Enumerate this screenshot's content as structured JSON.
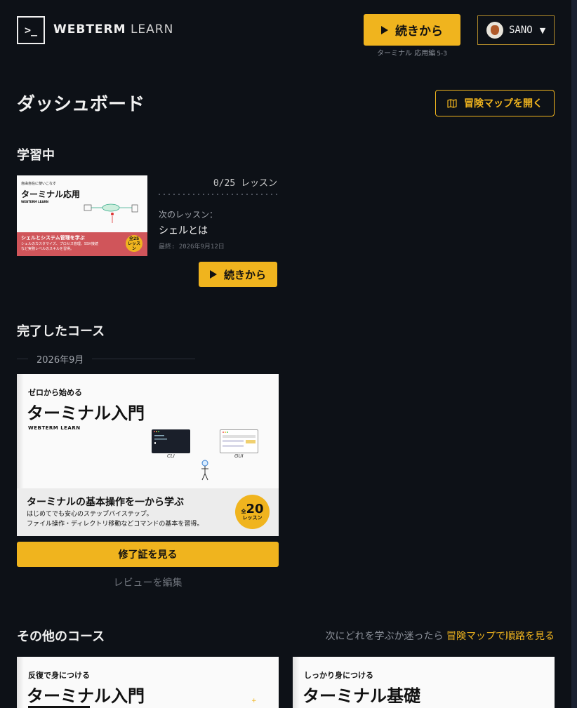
{
  "header": {
    "logo_glyph": ">_",
    "brand_bold": "WEBTERM",
    "brand_light": "LEARN",
    "continue_label": "続きから",
    "continue_sub": "ターミナル 応用編",
    "continue_sub_num": "5-3",
    "username": "SANO",
    "caret": "▼"
  },
  "dashboard": {
    "title": "ダッシュボード",
    "map_button": "冒険マップを開く"
  },
  "learning": {
    "section_title": "学習中",
    "thumb": {
      "top": "自由自在に使いこなす",
      "title": "ターミナル応用",
      "brand": "WEBTERM LEARN",
      "bottom_title": "シェルとシステム管理を学ぶ",
      "bottom_desc": "シェルのカスタマイズ、プロセス管理、SSH接続など実務レベルのスキルを習得。",
      "badge": "全25 レッスン"
    },
    "progress": "0/25 レッスン",
    "next_label": "次のレッスン：",
    "next_value": "シェルとは",
    "last_access": "最終: 2026年9月12日",
    "continue_label": "続きから"
  },
  "completed": {
    "section_title": "完了したコース",
    "date": "2026年9月",
    "thumb": {
      "top": "ゼロから始める",
      "title": "ターミナル入門",
      "brand": "WEBTERM LEARN",
      "cli_label": "CLI",
      "gui_label": "GUI",
      "bottom_title": "ターミナルの基本操作を一から学ぶ",
      "bottom_desc1": "はじめてでも安心のステップバイステップ。",
      "bottom_desc2": "ファイル操作・ディレクトリ移動などコマンドの基本を習得。",
      "badge_prefix": "全",
      "badge_num": "20",
      "badge_unit": "レッスン"
    },
    "certificate_button": "修了証を見る",
    "review_link": "レビューを編集"
  },
  "other": {
    "section_title": "その他のコース",
    "hint_prefix": "次にどれを学ぶか迷ったら",
    "hint_link": "冒険マップで順路を見る",
    "courses": [
      {
        "top": "反復で身につける",
        "title": "ターミナル入門"
      },
      {
        "top": "しっかり身につける",
        "title": "ターミナル基礎"
      }
    ]
  },
  "colors": {
    "background": "#0d1117",
    "accent": "#f0b41e",
    "thumb_red": "#d0555a"
  }
}
